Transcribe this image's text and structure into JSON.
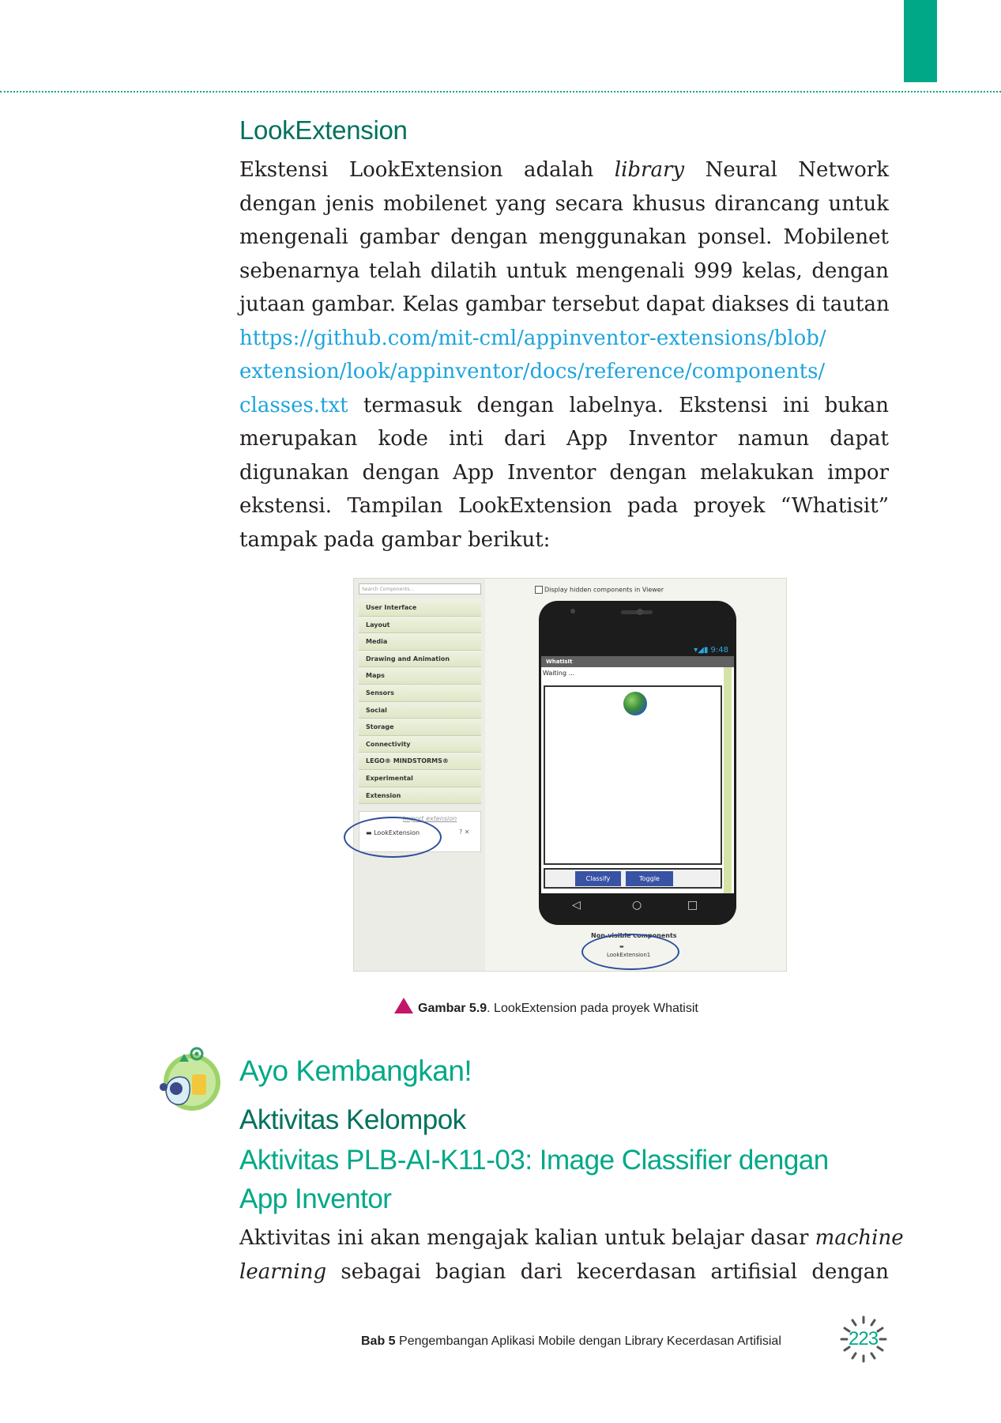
{
  "section": {
    "title": "LookExtension",
    "lines_p1": [
      [
        "Ekstensi LookExtension adalah ",
        "library",
        " Neural Network"
      ],
      "dengan jenis mobilenet yang secara khusus dirancang untuk",
      "mengenali gambar dengan menggunakan ponsel. Mobilenet",
      "sebenarnya telah dilatih untuk mengenali 999 kelas, dengan",
      "jutaan gambar. Kelas gambar tersebut dapat diakses di tautan"
    ],
    "link_line1": "https://github.com/mit-cml/appinventor-extensions/blob/",
    "link_line2": "extension/look/appinventor/docs/reference/components/",
    "link_line3": "classes.txt",
    "after_link": " termasuk dengan labelnya.   Ekstensi ini bukan",
    "lines_p2": [
      "merupakan kode inti dari App Inventor namun dapat",
      "digunakan dengan App Inventor dengan melakukan impor",
      "ekstensi. Tampilan LookExtension pada proyek “Whatisit”",
      "tampak pada gambar berikut:"
    ]
  },
  "figure": {
    "search_placeholder": "Search Components...",
    "palette": [
      "User Interface",
      "Layout",
      "Media",
      "Drawing and Animation",
      "Maps",
      "Sensors",
      "Social",
      "Storage",
      "Connectivity",
      "LEGO® MINDSTORMS®",
      "Experimental",
      "Extension"
    ],
    "import_extension": "Import extension",
    "extension_item": "LookExtension",
    "extension_btns": "? ✕",
    "hidden_components": "Display hidden components in Viewer",
    "status_time": "9:48",
    "app_title": "WhatIsIt",
    "waiting": "Waiting ...",
    "classify": "Classify",
    "toggle": "Toggle",
    "non_visible": "Non-visible components",
    "non_visible_item": "LookExtension1"
  },
  "caption": {
    "label": "Gambar 5.9",
    "text": ". LookExtension pada proyek Whatisit"
  },
  "activity": {
    "heading": "Ayo Kembangkan!",
    "sub": "Aktivitas Kelompok",
    "title_l1": "Aktivitas PLB-AI-K11-03: Image Classifier dengan",
    "title_l2": "App Inventor",
    "p_line1": [
      "Aktivitas ini akan mengajak kalian untuk belajar dasar ",
      "machine"
    ],
    "p_line2": [
      "learning",
      " sebagai bagian dari kecerdasan artifisial dengan"
    ]
  },
  "footer": {
    "chapter": "Bab 5",
    "title": " Pengembangan Aplikasi Mobile dengan Library Kecerdasan Artifisial",
    "page": "223"
  },
  "colors": {
    "accent": "#00a887",
    "heading_dark": "#00715c",
    "link": "#1ea4dc",
    "triangle": "#c2166b"
  }
}
